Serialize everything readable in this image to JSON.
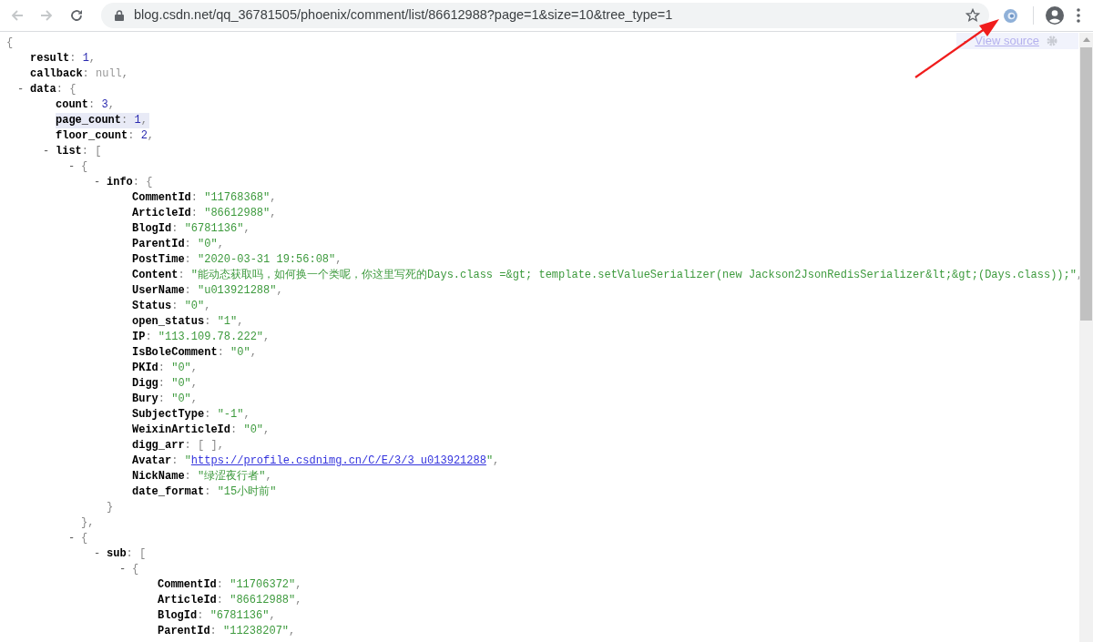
{
  "browser": {
    "url": "blog.csdn.net/qq_36781505/phoenix/comment/list/86612988?page=1&size=10&tree_type=1"
  },
  "viewer": {
    "collapse_toggle": "-",
    "view_source": "View source"
  },
  "tree": {
    "open": "{",
    "highlighted": false,
    "children": [
      {
        "key": "result",
        "sep": ":",
        "value": "1",
        "end": ",",
        "kind": "number",
        "highlighted": false
      },
      {
        "key": "callback",
        "sep": ":",
        "value": "null",
        "end": ",",
        "kind": "null",
        "highlighted": false
      },
      {
        "key": "data",
        "sep": ":",
        "open": "{",
        "toggle": "-",
        "expanded": true,
        "highlighted": false,
        "children": [
          {
            "key": "count",
            "sep": ":",
            "value": "3",
            "end": ",",
            "kind": "number",
            "highlighted": false
          },
          {
            "key": "page_count",
            "sep": ":",
            "value": "1",
            "end": ",",
            "kind": "number",
            "highlighted": true
          },
          {
            "key": "floor_count",
            "sep": ":",
            "value": "2",
            "end": ",",
            "kind": "number",
            "highlighted": false
          },
          {
            "key": "list",
            "sep": ":",
            "open": "[",
            "toggle": "-",
            "expanded": true,
            "highlighted": false,
            "children": [
              {
                "open": "{",
                "toggle": "-",
                "expanded": true,
                "highlighted": false,
                "close": "}",
                "end": ",",
                "children": [
                  {
                    "key": "info",
                    "sep": ":",
                    "open": "{",
                    "toggle": "-",
                    "expanded": true,
                    "highlighted": false,
                    "close": "}",
                    "children": [
                      {
                        "key": "CommentId",
                        "sep": ":",
                        "value": "\"11768368\"",
                        "end": ",",
                        "kind": "string",
                        "highlighted": false
                      },
                      {
                        "key": "ArticleId",
                        "sep": ":",
                        "value": "\"86612988\"",
                        "end": ",",
                        "kind": "string",
                        "highlighted": false
                      },
                      {
                        "key": "BlogId",
                        "sep": ":",
                        "value": "\"6781136\"",
                        "end": ",",
                        "kind": "string",
                        "highlighted": false
                      },
                      {
                        "key": "ParentId",
                        "sep": ":",
                        "value": "\"0\"",
                        "end": ",",
                        "kind": "string",
                        "highlighted": false
                      },
                      {
                        "key": "PostTime",
                        "sep": ":",
                        "value": "\"2020-03-31 19:56:08\"",
                        "end": ",",
                        "kind": "string",
                        "highlighted": false
                      },
                      {
                        "key": "Content",
                        "sep": ":",
                        "value": "\"能动态获取吗，如何换一个类呢，你这里写死的Days.class =&gt; template.setValueSerializer(new Jackson2JsonRedisSerializer&lt;&gt;(Days.class));\"",
                        "end": ",",
                        "kind": "string",
                        "highlighted": false
                      },
                      {
                        "key": "UserName",
                        "sep": ":",
                        "value": "\"u013921288\"",
                        "end": ",",
                        "kind": "string",
                        "highlighted": false
                      },
                      {
                        "key": "Status",
                        "sep": ":",
                        "value": "\"0\"",
                        "end": ",",
                        "kind": "string",
                        "highlighted": false
                      },
                      {
                        "key": "open_status",
                        "sep": ":",
                        "value": "\"1\"",
                        "end": ",",
                        "kind": "string",
                        "highlighted": false
                      },
                      {
                        "key": "IP",
                        "sep": ":",
                        "value": "\"113.109.78.222\"",
                        "end": ",",
                        "kind": "string",
                        "highlighted": false
                      },
                      {
                        "key": "IsBoleComment",
                        "sep": ":",
                        "value": "\"0\"",
                        "end": ",",
                        "kind": "string",
                        "highlighted": false
                      },
                      {
                        "key": "PKId",
                        "sep": ":",
                        "value": "\"0\"",
                        "end": ",",
                        "kind": "string",
                        "highlighted": false
                      },
                      {
                        "key": "Digg",
                        "sep": ":",
                        "value": "\"0\"",
                        "end": ",",
                        "kind": "string",
                        "highlighted": false
                      },
                      {
                        "key": "Bury",
                        "sep": ":",
                        "value": "\"0\"",
                        "end": ",",
                        "kind": "string",
                        "highlighted": false
                      },
                      {
                        "key": "SubjectType",
                        "sep": ":",
                        "value": "\"-1\"",
                        "end": ",",
                        "kind": "string",
                        "highlighted": false
                      },
                      {
                        "key": "WeixinArticleId",
                        "sep": ":",
                        "value": "\"0\"",
                        "end": ",",
                        "kind": "string",
                        "highlighted": false
                      },
                      {
                        "key": "digg_arr",
                        "sep": ":",
                        "value": "[ ]",
                        "end": ",",
                        "kind": "array",
                        "highlighted": false
                      },
                      {
                        "key": "Avatar",
                        "sep": ":",
                        "quote": "\"",
                        "value": "https://profile.csdnimg.cn/C/E/3/3_u013921288",
                        "end": ",",
                        "kind": "link",
                        "highlighted": false
                      },
                      {
                        "key": "NickName",
                        "sep": ":",
                        "value": "\"绿涩夜行者\"",
                        "end": ",",
                        "kind": "string",
                        "highlighted": false
                      },
                      {
                        "key": "date_format",
                        "sep": ":",
                        "value": "\"15小时前\"",
                        "kind": "string",
                        "highlighted": false
                      }
                    ]
                  }
                ]
              },
              {
                "open": "{",
                "toggle": "-",
                "expanded": true,
                "highlighted": false,
                "children": [
                  {
                    "key": "sub",
                    "sep": ":",
                    "open": "[",
                    "toggle": "-",
                    "expanded": true,
                    "highlighted": false,
                    "children": [
                      {
                        "open": "{",
                        "toggle": "-",
                        "expanded": true,
                        "highlighted": false,
                        "children": [
                          {
                            "key": "CommentId",
                            "sep": ":",
                            "value": "\"11706372\"",
                            "end": ",",
                            "kind": "string",
                            "highlighted": false
                          },
                          {
                            "key": "ArticleId",
                            "sep": ":",
                            "value": "\"86612988\"",
                            "end": ",",
                            "kind": "string",
                            "highlighted": false
                          },
                          {
                            "key": "BlogId",
                            "sep": ":",
                            "value": "\"6781136\"",
                            "end": ",",
                            "kind": "string",
                            "highlighted": false
                          },
                          {
                            "key": "ParentId",
                            "sep": ":",
                            "value": "\"11238207\"",
                            "end": ",",
                            "kind": "string",
                            "highlighted": false
                          }
                        ]
                      }
                    ]
                  }
                ]
              }
            ]
          }
        ]
      }
    ]
  }
}
